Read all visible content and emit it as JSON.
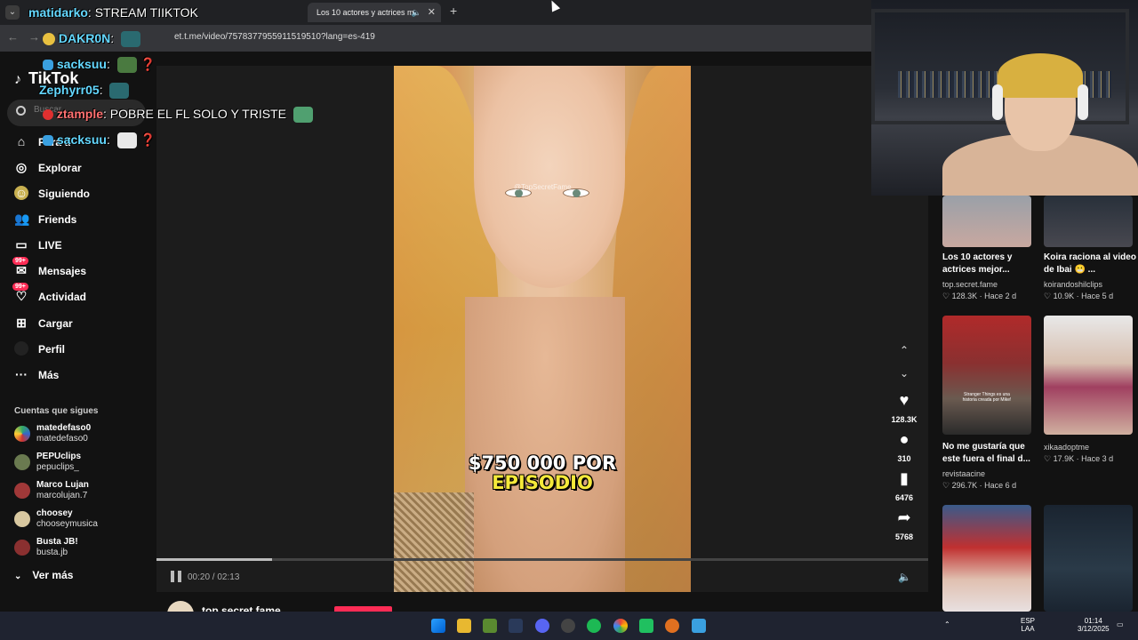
{
  "browser": {
    "active_tab_title": "Los 10 actores y actrices m",
    "url": "et.t.me/video/7578377955911519510?lang=es-419"
  },
  "chat": [
    {
      "user": "matidarko",
      "message": "STREAM TIIKTOK"
    },
    {
      "user": "DAKR0N",
      "message": ""
    },
    {
      "user": "sacksuu",
      "message": ""
    },
    {
      "user": "Zephyrr05",
      "message": ""
    },
    {
      "user": "ztample",
      "message": "POBRE EL FL SOLO Y TRISTE"
    },
    {
      "user": "sacksuu",
      "message": ""
    }
  ],
  "sidebar": {
    "logo": "TikTok",
    "search_placeholder": "Buscar",
    "items": [
      {
        "label": "Para ti",
        "icon": "home-icon"
      },
      {
        "label": "Explorar",
        "icon": "compass-icon"
      },
      {
        "label": "Siguiendo",
        "icon": "following-icon"
      },
      {
        "label": "Friends",
        "icon": "friends-icon"
      },
      {
        "label": "LIVE",
        "icon": "live-icon"
      },
      {
        "label": "Mensajes",
        "icon": "messages-icon",
        "badge": "99+"
      },
      {
        "label": "Actividad",
        "icon": "activity-icon",
        "badge": "99+"
      },
      {
        "label": "Cargar",
        "icon": "upload-icon"
      },
      {
        "label": "Perfil",
        "icon": "profile-icon"
      },
      {
        "label": "Más",
        "icon": "more-icon"
      }
    ],
    "following_title": "Cuentas que sigues",
    "following": [
      {
        "name": "matedefaso0",
        "handle": "matedefaso0"
      },
      {
        "name": "PEPUclips",
        "handle": "pepuclips_"
      },
      {
        "name": "Marco Lujan",
        "handle": "marcolujan.7"
      },
      {
        "name": "choosey",
        "handle": "chooseymusica"
      },
      {
        "name": "Busta JB!",
        "handle": "busta.jb"
      }
    ],
    "see_more": "Ver más"
  },
  "video": {
    "watermark": "@TopSecretFame",
    "caption_line1": "$750 000 POR",
    "caption_line2": "EPISODIO",
    "time": "00:20 / 02:13",
    "progress": 0.15,
    "author": "top.secret.fame"
  },
  "actions": {
    "likes": "128.3K",
    "comments": "310",
    "saves": "6476",
    "shares": "5768"
  },
  "recommendations": [
    {
      "title": "Los 10 actores y actrices mejor...",
      "author": "top.secret.fame",
      "likes": "128.3K",
      "date": "Hace 2 d"
    },
    {
      "title": "Koira raciona al video de Ibai 😬 ...",
      "author": "koirandoshilclips",
      "likes": "10.9K",
      "date": "Hace 5 d"
    },
    {
      "title": "No me gustaría que este fuera el final d...",
      "author": "revistaacine",
      "likes": "296.7K",
      "date": "Hace 6 d"
    },
    {
      "title": "",
      "author": "xikaadoptme",
      "likes": "17.9K",
      "date": "Hace 3 d"
    }
  ],
  "thumb_caption": "Stranger Things es una historia creada por Mike!",
  "taskbar": {
    "lang1": "ESP",
    "lang2": "LAA",
    "time": "01:14",
    "date": "3/12/2025"
  }
}
